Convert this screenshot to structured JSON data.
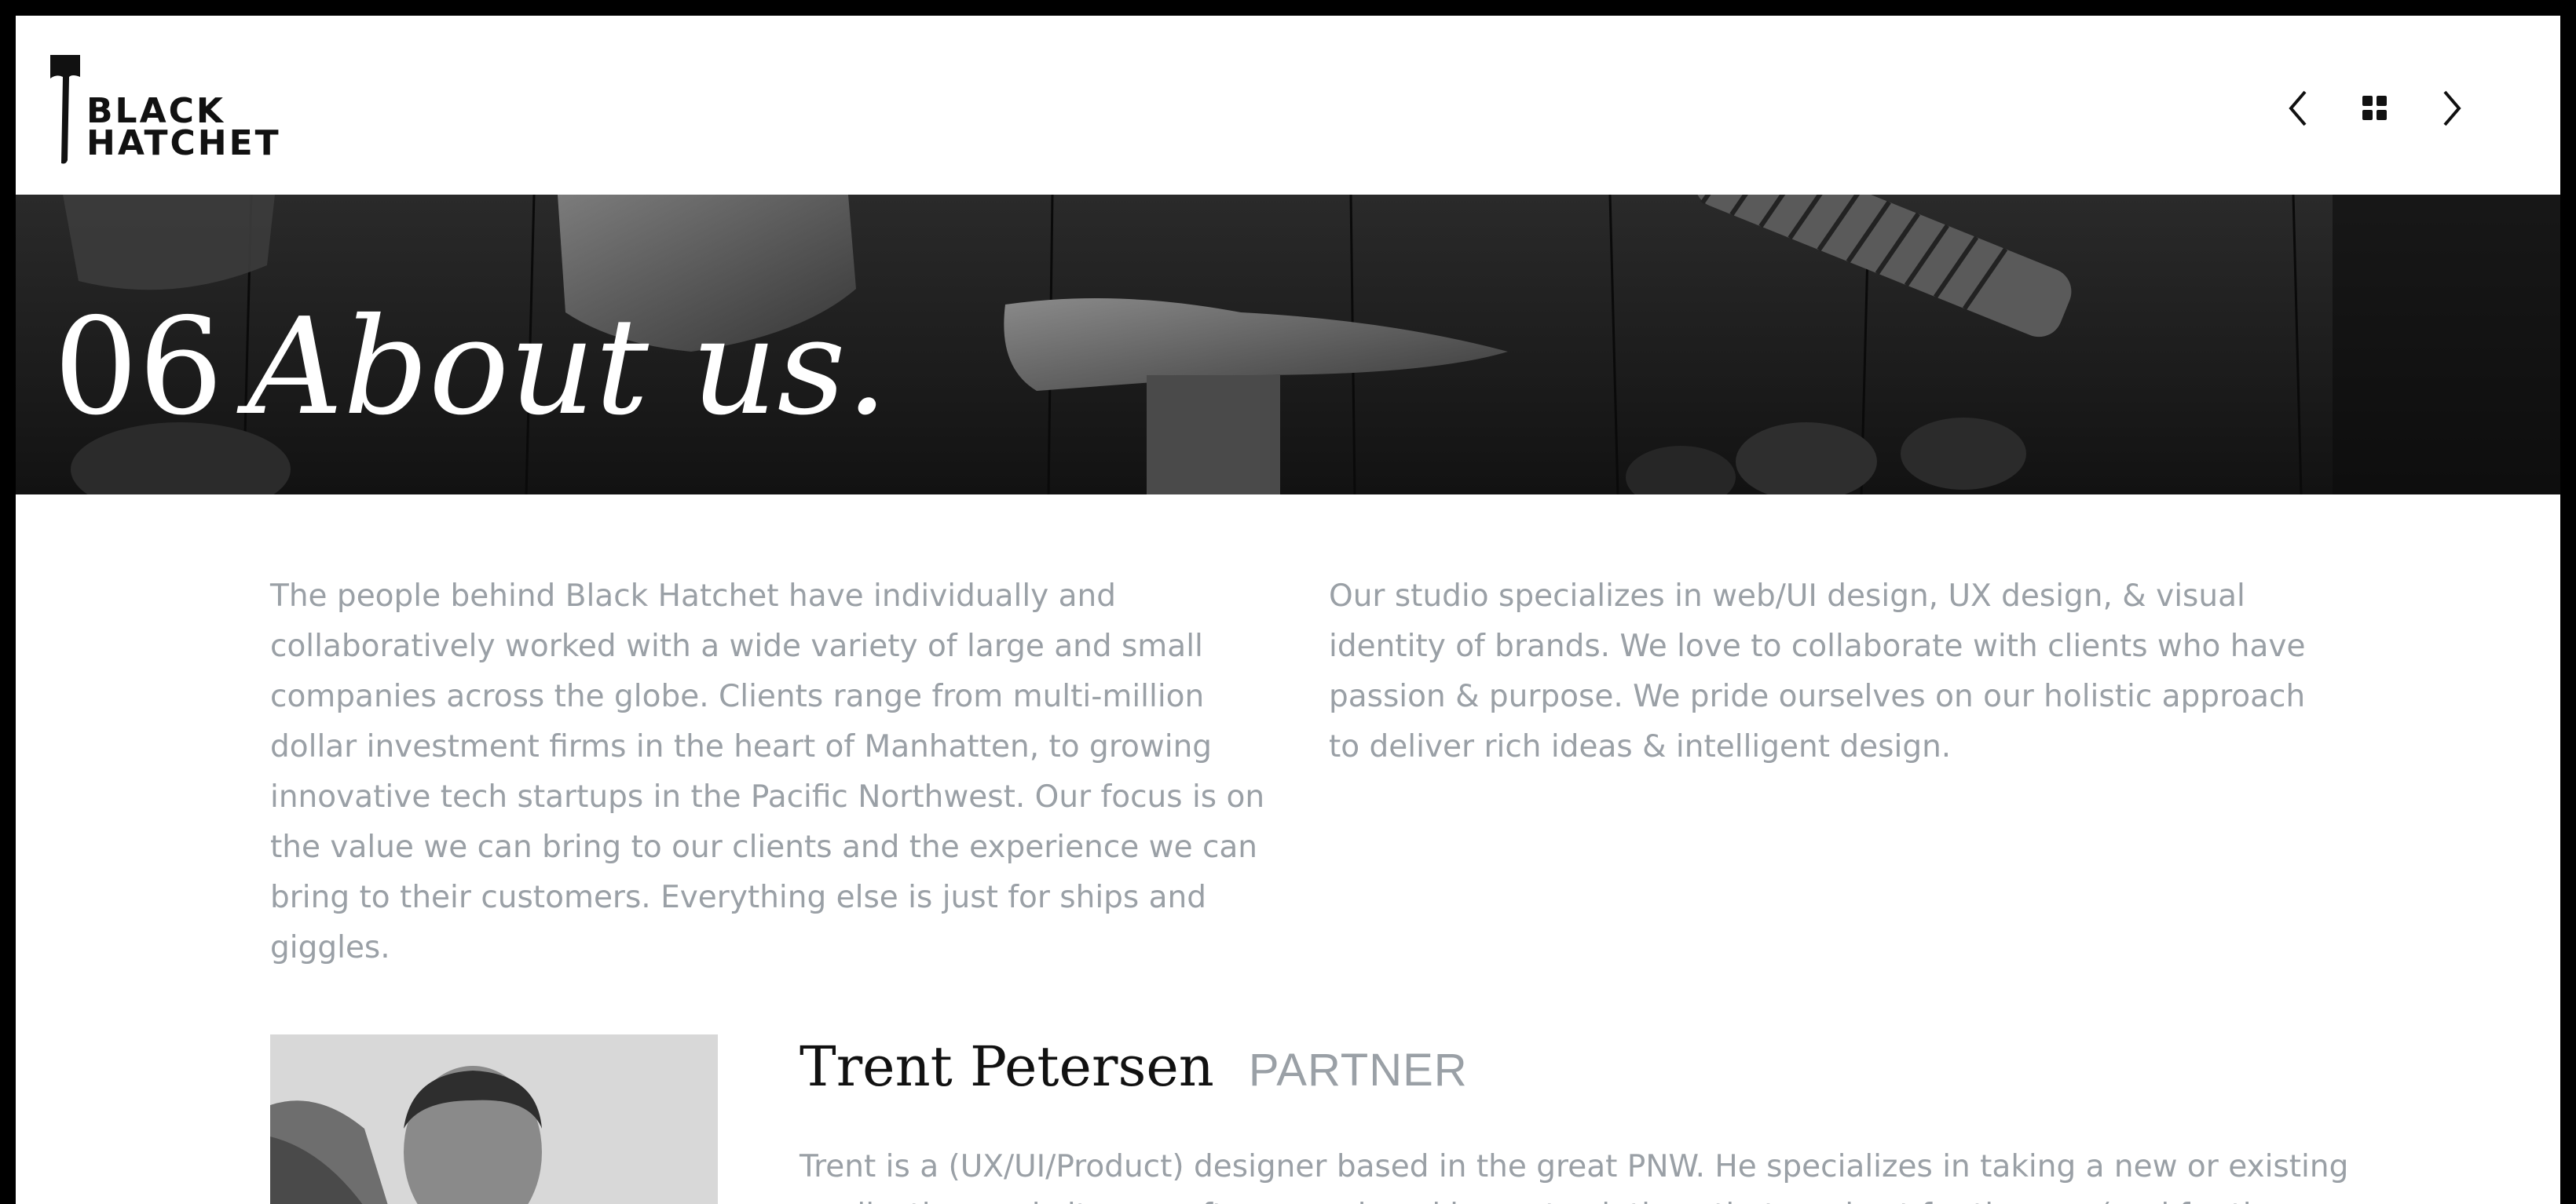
{
  "brand": {
    "logo_line1": "BLACK",
    "logo_line2": "HATCHET"
  },
  "nav": {
    "prev_icon": "chevron-left-icon",
    "grid_icon": "grid-icon",
    "next_icon": "chevron-right-icon"
  },
  "hero": {
    "number": "06",
    "title": "About us."
  },
  "intro": {
    "paragraph_left": "The people behind Black Hatchet have individually and collaboratively worked with a wide variety of large and small companies across the globe. Clients range from multi-million dollar investment firms in the heart of Manhatten, to growing innovative tech startups in the Pacific Northwest. Our focus is on the value we can bring to our clients and the experience we can bring to their customers. Everything else is just for ships and giggles.",
    "paragraph_right": "Our studio specializes in web/UI design, UX design, & visual identity of brands. We love to collaborate with clients who have passion & purpose. We pride ourselves on our holistic approach to deliver rich ideas & intelligent design."
  },
  "team": {
    "members": [
      {
        "name": "Trent Petersen",
        "role": "PARTNER",
        "bio": "Trent is a (UX/UI/Product) designer based in the great PNW. He specializes in taking a new or existing application, website, or software and working out solutions that are best for the user(and for the"
      }
    ]
  },
  "colors": {
    "frame": "#000000",
    "text_muted": "#9aa0a6",
    "text_dark": "#111111",
    "hero_bg": "#161616"
  }
}
